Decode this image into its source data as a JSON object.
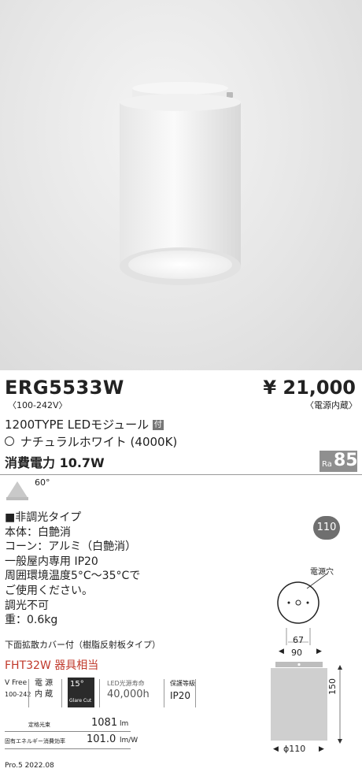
{
  "product": {
    "model": "ERG5533W",
    "voltage": "〈100-242V〉",
    "price": "¥ 21,000",
    "price_note": "〈電源内蔵〉",
    "module": "1200TYPE LEDモジュール",
    "module_badge": "付",
    "color_temp": "ナチュラルホワイト (4000K)",
    "power": "消費電力 10.7W",
    "ra_label": "Ra",
    "ra_value": "85",
    "beam_angle": "60°",
    "ring_badge": "110"
  },
  "specs": {
    "lines": [
      "■非調光タイプ",
      "本体：白艶消",
      "コーン：アルミ（白艶消）",
      "一般屋内専用 IP20",
      "周囲環境温度5°C～35°Cで",
      "ご使用ください。",
      "調光不可",
      "重：0.6kg"
    ],
    "cover_note": "下面拡散カバー付（樹脂反射板タイプ）",
    "equivalent": "FHT32W 器具相当"
  },
  "icons": {
    "vfree_label": "V Free",
    "vfree_range": "100-242",
    "power_supply": "電 源\n内 蔵",
    "glare_angle": "15°",
    "glare_label": "Glare Cut",
    "led_life_label": "LED光源寿命",
    "led_life_value": "40,000h",
    "protection_label": "保護等級",
    "protection_value": "IP20"
  },
  "performance": {
    "flux_label": "定格光束",
    "flux_value": "1081",
    "flux_unit": "lm",
    "eff_label": "固有エネルギー消費効率",
    "eff_value": "101.0",
    "eff_unit": "lm/W"
  },
  "drawing": {
    "power_hole_label": "電源穴",
    "dim_67": "67",
    "dim_90": "90",
    "dim_150": "150",
    "dim_110": "ϕ110"
  },
  "footer": {
    "version": "Pro.5 2022.08"
  }
}
